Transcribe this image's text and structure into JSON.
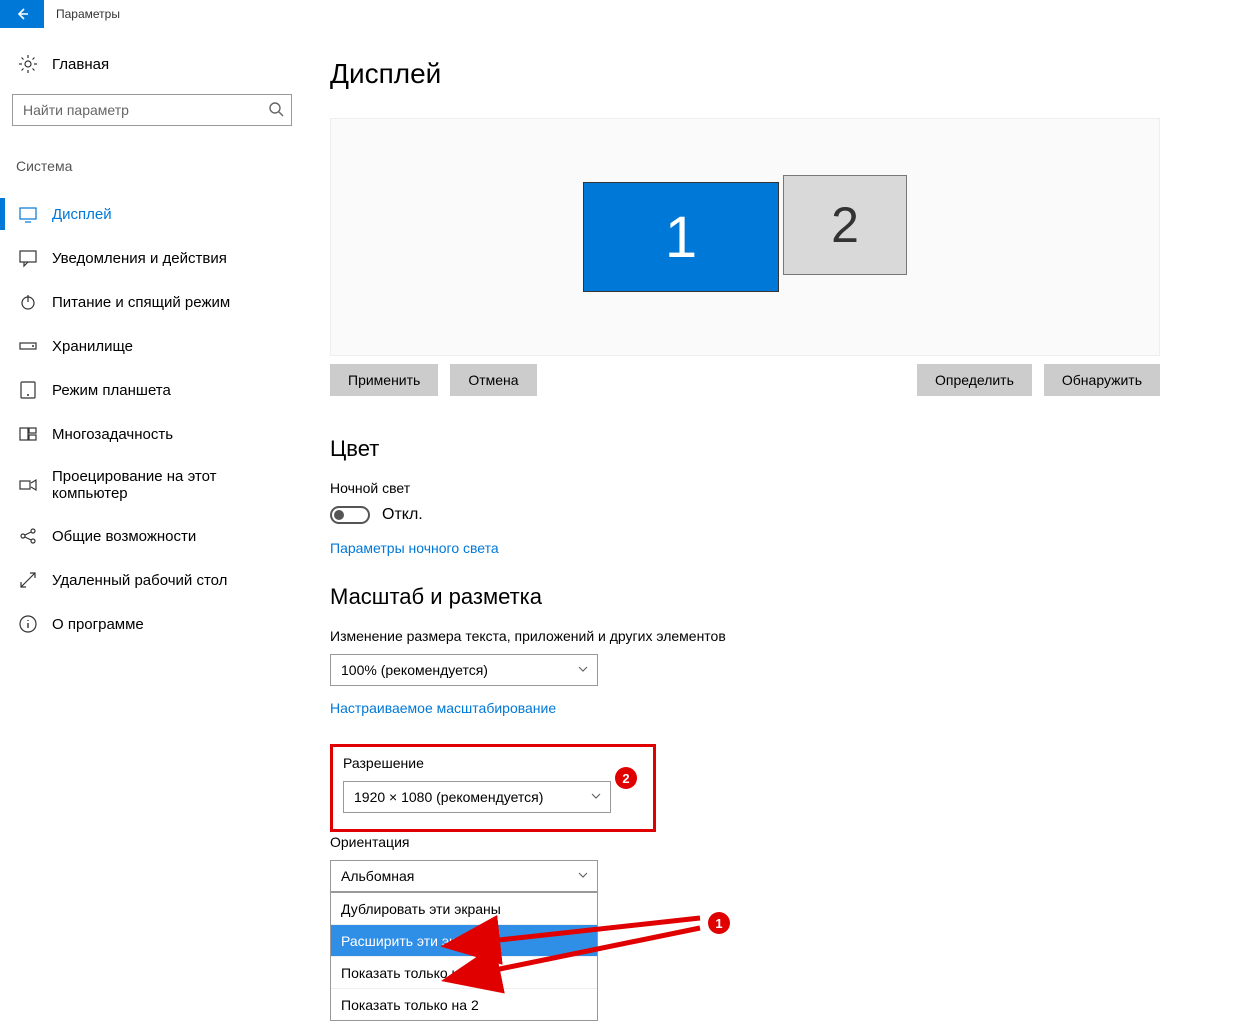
{
  "window": {
    "title": "Параметры"
  },
  "sidebar": {
    "home": "Главная",
    "search_placeholder": "Найти параметр",
    "group": "Система",
    "items": [
      "Дисплей",
      "Уведомления и действия",
      "Питание и спящий режим",
      "Хранилище",
      "Режим планшета",
      "Многозадачность",
      "Проецирование на этот компьютер",
      "Общие возможности",
      "Удаленный рабочий стол",
      "О программе"
    ]
  },
  "page": {
    "title": "Дисплей",
    "monitors": {
      "m1": "1",
      "m2": "2"
    },
    "buttons": {
      "apply": "Применить",
      "cancel": "Отмена",
      "identify": "Определить",
      "detect": "Обнаружить"
    },
    "color": {
      "heading": "Цвет",
      "night_label": "Ночной свет",
      "night_state": "Откл.",
      "night_link": "Параметры ночного света"
    },
    "scale": {
      "heading": "Масштаб и разметка",
      "size_label": "Изменение размера текста, приложений и других элементов",
      "size_value": "100% (рекомендуется)",
      "custom_link": "Настраиваемое масштабирование",
      "res_label": "Разрешение",
      "res_value": "1920 × 1080 (рекомендуется)",
      "orient_label": "Ориентация",
      "orient_value": "Альбомная"
    },
    "multi": {
      "opt1": "Дублировать эти экраны",
      "opt2": "Расширить эти экраны",
      "opt3": "Показать только на 1",
      "opt4": "Показать только на 2"
    },
    "callouts": {
      "one": "1",
      "two": "2"
    }
  }
}
